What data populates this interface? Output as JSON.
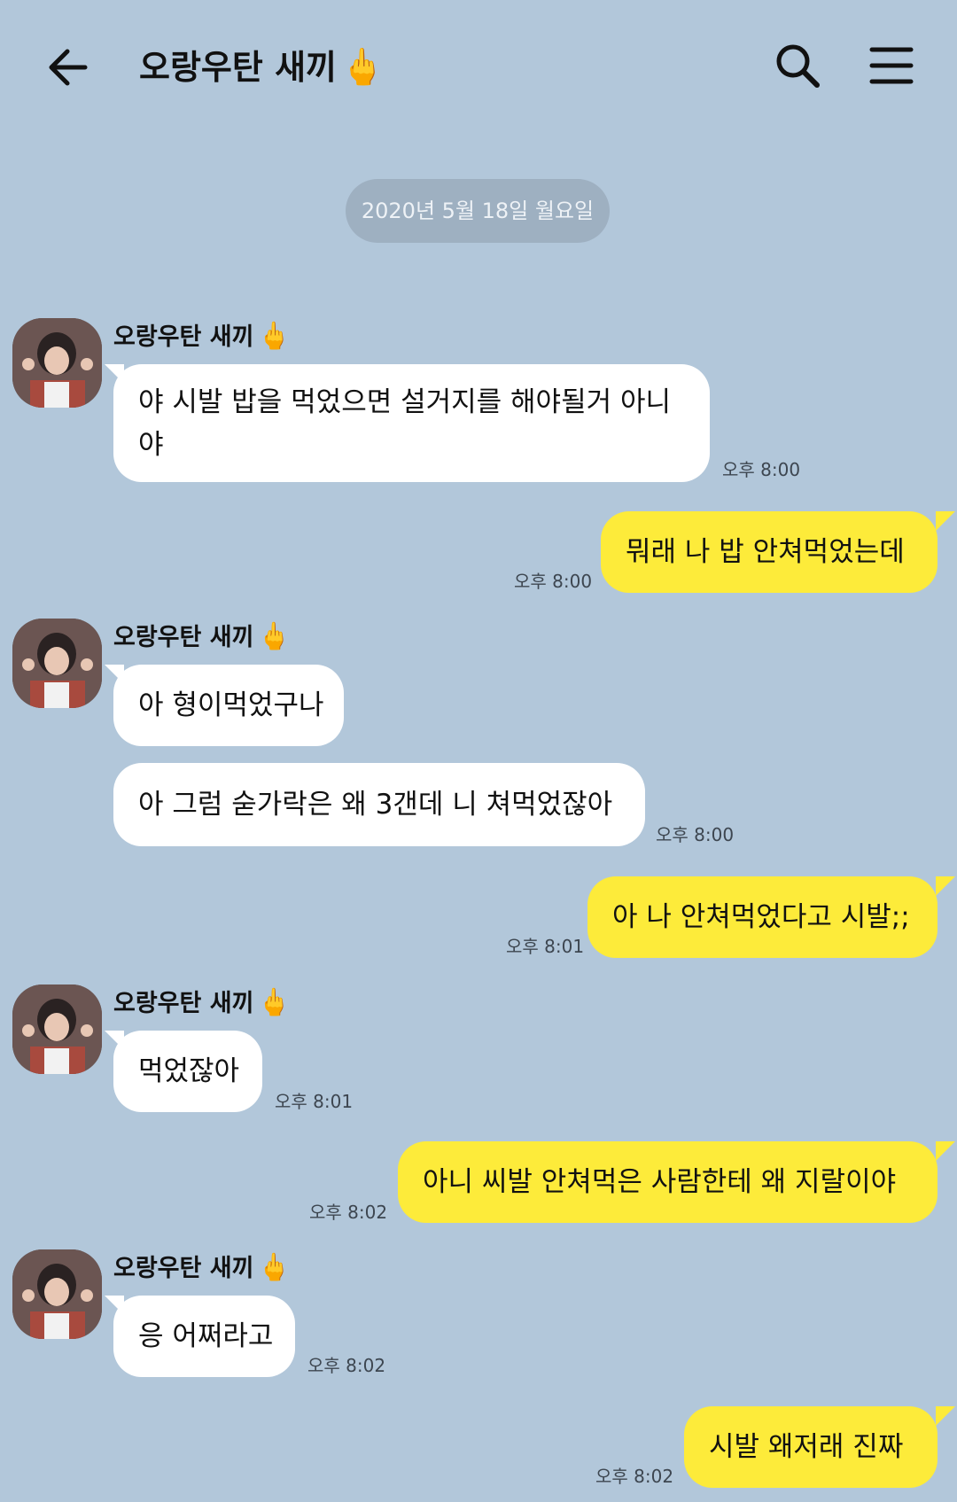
{
  "header": {
    "title": "오랑우탄 새끼",
    "title_emoji": "🖕"
  },
  "date_divider": "2020년 5월 18일 월요일",
  "contact": {
    "name": "오랑우탄 새끼",
    "emoji": "🖕"
  },
  "messages": [
    {
      "text": "야 시발 밥을 먹었으면 설거지를 해야될거 아니야",
      "time": "오후 8:00"
    },
    {
      "text": "뭐래 나 밥 안쳐먹었는데",
      "time": "오후 8:00"
    },
    {
      "text": "아 형이먹었구나",
      "time": ""
    },
    {
      "text": "아 그럼 숟가락은 왜 3갠데 니 쳐먹었잖아",
      "time": "오후 8:00"
    },
    {
      "text": "아 나 안쳐먹었다고 시발;;",
      "time": "오후 8:01"
    },
    {
      "text": "먹었잖아",
      "time": "오후 8:01"
    },
    {
      "text": "아니 씨발 안쳐먹은 사람한테 왜 지랄이야",
      "time": "오후 8:02"
    },
    {
      "text": "응 어쩌라고",
      "time": "오후 8:02"
    },
    {
      "text": "시발 왜저래 진짜",
      "time": "오후 8:02"
    }
  ],
  "colors": {
    "background": "#b2c7da",
    "incoming_bubble": "#ffffff",
    "outgoing_bubble": "#fdeb3a",
    "date_pill": "#9eb0c1"
  },
  "icons": {
    "back": "arrow-left-icon",
    "search": "search-icon",
    "menu": "hamburger-menu-icon"
  }
}
